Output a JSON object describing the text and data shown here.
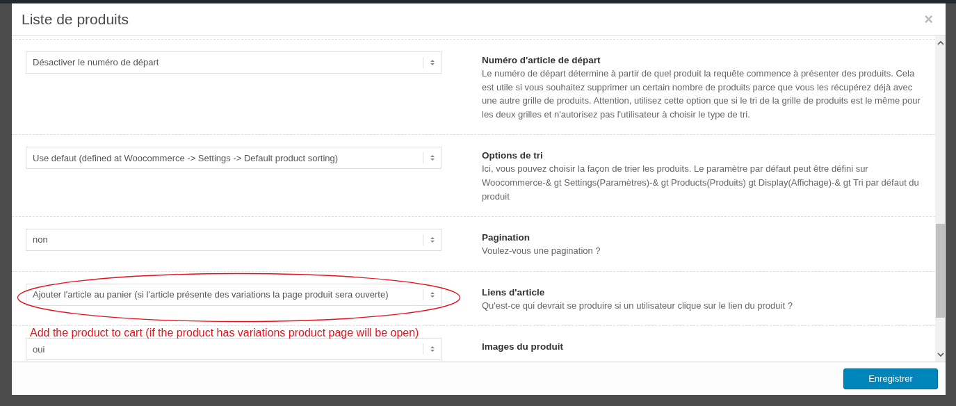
{
  "modal": {
    "title": "Liste de produits",
    "close": "×"
  },
  "settings": [
    {
      "value": "Désactiver le numéro de départ",
      "label": "Numéro d'article de départ",
      "description": "Le numéro de départ détermine à partir de quel produit la requête commence à présenter des produits. Cela est utile si vous souhaitez supprimer un certain nombre de produits parce que vous les récupérez déjà avec une autre grille de produits. Attention, utilisez cette option que si le tri de la grille de produits est le même pour les deux grilles et n'autorisez pas l'utilisateur à choisir le type de tri."
    },
    {
      "value": "Use defaut (defined at Woocommerce -> Settings -> Default product sorting)",
      "label": "Options de tri",
      "description": "Ici, vous pouvez choisir la façon de trier les produits. Le paramètre par défaut peut être défini sur Woocommerce-& gt Settings(Paramètres)-& gt Products(Produits) gt Display(Affichage)-& gt Tri par défaut du produit"
    },
    {
      "value": "non",
      "label": "Pagination",
      "description": "Voulez-vous une pagination ?"
    },
    {
      "value": "Ajouter l'article au panier (si l'article présente des variations la page produit sera ouverte)",
      "label": "Liens d'article",
      "description": "Qu'est-ce qui devrait se produire si un utilisateur clique sur le lien du produit ?"
    },
    {
      "value": "oui",
      "label": "Images du produit"
    }
  ],
  "annotation": {
    "text": "Add the product to cart (if the product has variations product page will be open)"
  },
  "footer": {
    "button": "Enregistrer"
  }
}
